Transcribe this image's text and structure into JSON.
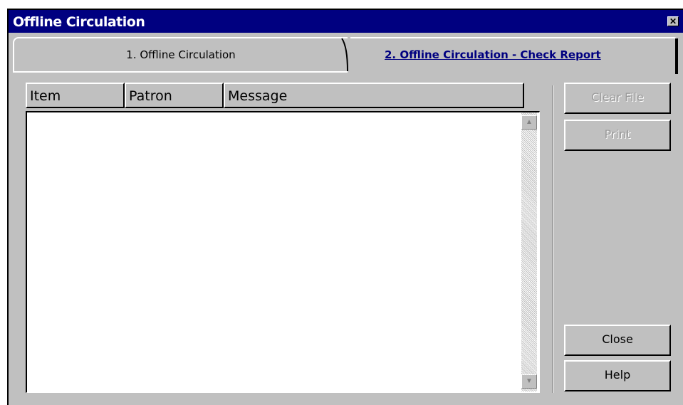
{
  "window": {
    "title": "Offline Circulation",
    "close_glyph": "✕"
  },
  "tabs": [
    {
      "label": "1. Offline Circulation",
      "active": false
    },
    {
      "label": "2. Offline Circulation - Check Report",
      "active": true
    }
  ],
  "grid": {
    "columns": [
      "Item",
      "Patron",
      "Message"
    ],
    "rows": []
  },
  "scrollbar": {
    "up_glyph": "▲",
    "down_glyph": "▼"
  },
  "buttons": {
    "clear_file": "Clear File",
    "print": "Print",
    "close": "Close",
    "help": "Help"
  },
  "colors": {
    "titlebar": "#000080",
    "face": "#c0c0c0",
    "active_tab_text": "#000080"
  }
}
